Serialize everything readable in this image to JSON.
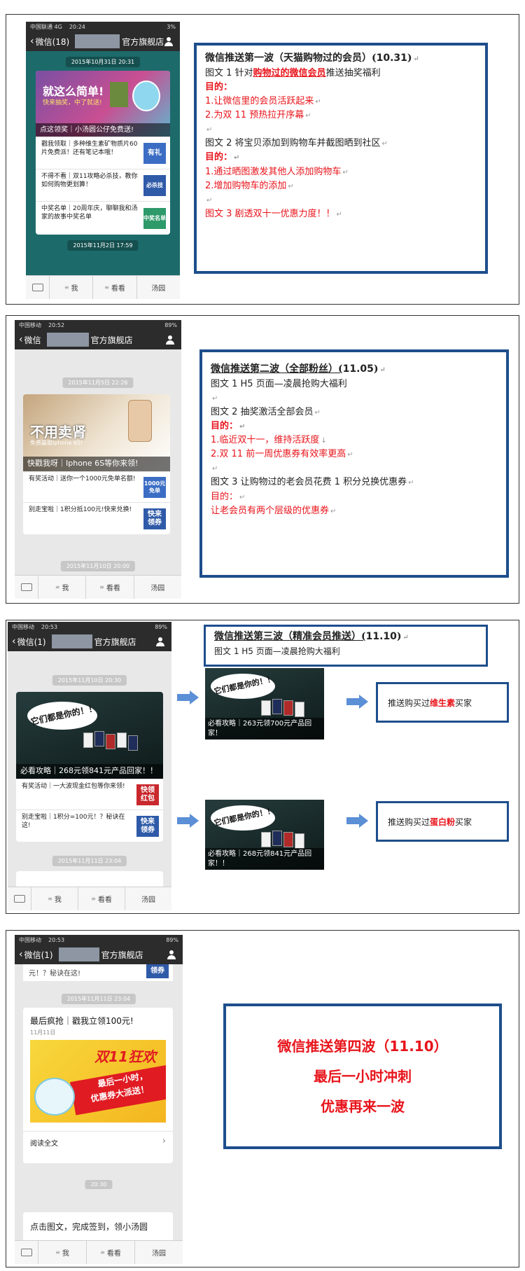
{
  "tabbar": {
    "me": "我",
    "look": "看看",
    "tangyuan": "汤园"
  },
  "panel1": {
    "phone": {
      "status": {
        "carrier": "中国联通  4G",
        "time": "20:24",
        "battery": "3%"
      },
      "nav": {
        "back": "微信(18)",
        "title": "官方旗舰店"
      },
      "stamp1": "2015年10月31日 20:31",
      "banner": {
        "line1": "就这么简单!",
        "line2": "快来抽奖，中了就送!",
        "caption": "点这领奖｜小汤圆公仔免费送!"
      },
      "rows": [
        {
          "text": "戳我领取｜多种维生素矿物质片60片免费派！还有笔记本哦！",
          "thumb": "有礼"
        },
        {
          "text": "不得不看｜双11攻略必杀技，教你如何购物更划算！",
          "thumb": "必杀技"
        },
        {
          "text": "中奖名单｜20周年庆，聊聊我和汤家的故事中奖名单",
          "thumb": "中奖名单"
        }
      ],
      "stamp2": "2015年11月2日 17:59"
    },
    "box": {
      "title_a": "微信推送第一波（天猫购物过的会员）(",
      "title_num": "10.31",
      "title_b": ")",
      "l1_a": "图文 1   针对",
      "l1_red": "购物过的微信会员",
      "l1_b": "推送抽奖福利",
      "goal": "目的：",
      "g1": "1.让微信里的会员活跃起来",
      "g2": "2.为双 11 预热拉开序幕",
      "l2": "图文 2   将宝贝添加到购物车并截图晒到社区",
      "goal2": "目的：",
      "g3": "1.通过晒图激发其他人添加购物车",
      "g4": "2.增加购物车的添加",
      "l3": "图文 3  剧透双十一优惠力度！！"
    }
  },
  "panel2": {
    "phone": {
      "status": {
        "carrier": "中国移动",
        "time": "20:52",
        "battery": "89%"
      },
      "nav": {
        "back": "微信",
        "title": "官方旗舰店"
      },
      "stamp1": "2015年11月5日 22:26",
      "banner": {
        "line1": "不用卖肾",
        "line2": "免费赢取Iphone 6S!",
        "caption": "快戳我呀｜Iphone 6S等你来领!"
      },
      "rows": [
        {
          "text": "有奖活动｜送你一个1000元免单名额!",
          "thumb": "1000元 免单"
        },
        {
          "text": "别走宝啦｜1积分抵100元!快来兑换!",
          "thumb": "快来 领券"
        }
      ],
      "stamp2": "2015年11月10日 20:00"
    },
    "box": {
      "title_a": "微信推送第二波（全部粉丝）(",
      "title_num": "11.05",
      "title_b": ")",
      "l1": "图文 1   H5 页面—凌晨抢购大福利",
      "l2": "图文 2   抽奖激活全部会员",
      "goal": "目的：",
      "g1": "1.临近双十一，维持活跃度",
      "g2": "2.双 11 前一周优惠券有效率更高",
      "l3": "图文 3  让购物过的老会员花费 1 积分兑换优惠券",
      "goal2": "目的：",
      "g3": "让老会员有两个层级的优惠券"
    }
  },
  "panel3": {
    "phone": {
      "status": {
        "carrier": "中国移动",
        "time": "20:53",
        "battery": "89%"
      },
      "nav": {
        "back": "微信(1)",
        "title": "官方旗舰店"
      },
      "stamp1": "2015年11月10日 20:30",
      "banner": {
        "bubble": "它们都是你的！！",
        "caption": "必看攻略｜268元领841元产品回家！！"
      },
      "rows": [
        {
          "text": "有奖活动｜一大波现金红包等你来领!",
          "thumb": "快领 红包"
        },
        {
          "text": "别走宝啦｜1积分=100元！？秘诀在这!",
          "thumb": "快来 领券"
        }
      ],
      "stamp2": "2015年11月11日 23:04"
    },
    "box": {
      "title_a": "微信推送第三波（精准会员推送）(",
      "title_num": "11.10",
      "title_b": ")",
      "l1": "图文 1   H5 页面—凌晨抢购大福利"
    },
    "split1": {
      "bubble": "它们都是你的！！",
      "caption": "必看攻略｜263元领700元产品回家！",
      "push_a": "推送购买过",
      "push_red": "维生素",
      "push_b": "买家"
    },
    "split2": {
      "bubble": "它们都是你的！！",
      "caption": "必看攻略｜268元领841元产品回家！！",
      "push_a": "推送购买过",
      "push_red": "蛋白粉",
      "push_b": "买家"
    }
  },
  "panel4": {
    "phone": {
      "status": {
        "carrier": "中国移动",
        "time": "20:53",
        "battery": "89%"
      },
      "nav": {
        "back": "微信(1)",
        "title": "官方旗舰店"
      },
      "cut_text": "元！？秘诀在这!",
      "cut_thumb": "领券",
      "stamp1": "2015年11月11日 23:04",
      "article": {
        "title": "最后疯抢｜戳我立领100元!",
        "date": "11月11日",
        "banner_title": "双11狂欢",
        "ribbon1": "最后一小时，",
        "ribbon2": "优惠券大派送！",
        "read_more": "阅读全文"
      },
      "stamp2": "20:30",
      "cut_bottom": "点击图文，完成签到，领小汤圆"
    },
    "box": {
      "line1": "微信推送第四波（11.10）",
      "line2": "最后一小时冲刺",
      "line3": "优惠再来一波"
    }
  }
}
